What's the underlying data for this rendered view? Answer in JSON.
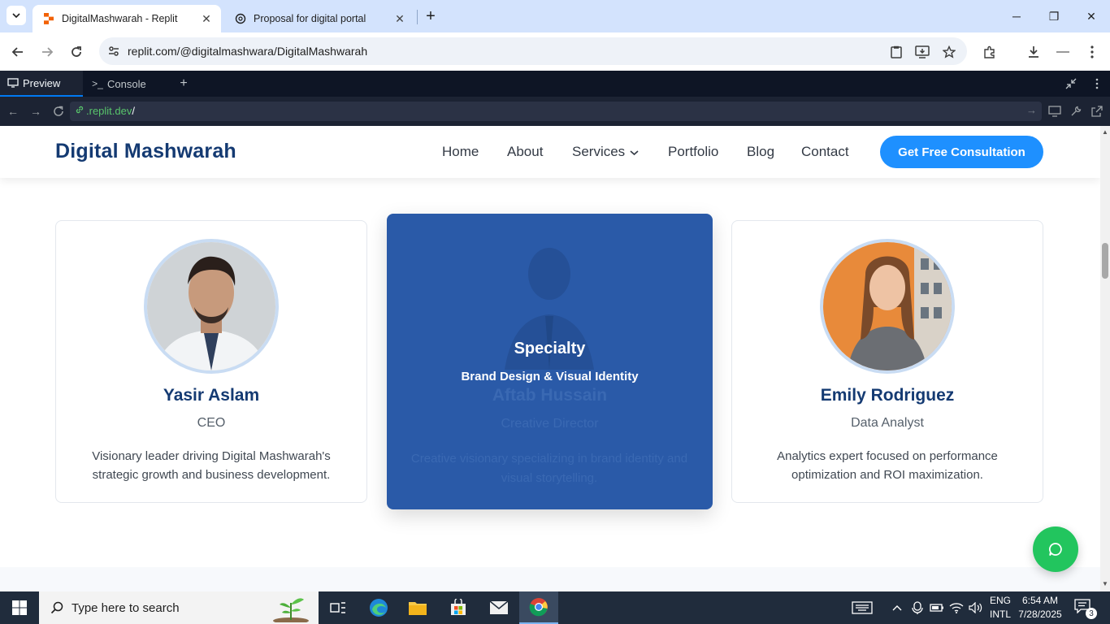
{
  "browser": {
    "tabs": [
      {
        "title": "DigitalMashwarah - Replit",
        "active": true,
        "icon": "replit-icon"
      },
      {
        "title": "Proposal for digital portal",
        "active": false,
        "icon": "openai-icon"
      }
    ],
    "url": "replit.com/@digitalmashwara/DigitalMashwarah"
  },
  "replit": {
    "tabs": [
      {
        "label": "Preview",
        "icon": "monitor-icon"
      },
      {
        "label": "Console",
        "icon": "terminal-icon"
      }
    ],
    "address": {
      "domain": ".replit.dev",
      "path": "/"
    }
  },
  "site": {
    "logo": "Digital Mashwarah",
    "nav": [
      "Home",
      "About",
      "Services",
      "Portfolio",
      "Blog",
      "Contact"
    ],
    "cta": "Get Free Consultation",
    "team": [
      {
        "name": "Yasir Aslam",
        "role": "CEO",
        "desc": "Visionary leader driving Digital Mashwarah's strategic growth and business development."
      },
      {
        "name": "Aftab Hussain",
        "role": "Creative Director",
        "desc": "Creative visionary specializing in brand identity and visual storytelling.",
        "overlay_title": "Specialty",
        "overlay_text": "Brand Design & Visual Identity"
      },
      {
        "name": "Emily Rodriguez",
        "role": "Data Analyst",
        "desc": "Analytics expert focused on performance optimization and ROI maximization."
      }
    ],
    "colors": {
      "brand_navy": "#143a72",
      "cta_blue": "#1e90ff",
      "hover_card": "#2a5aa8",
      "chat_green": "#22c55e"
    }
  },
  "taskbar": {
    "search_placeholder": "Type here to search",
    "lang_top": "ENG",
    "lang_bottom": "INTL",
    "time": "6:54 AM",
    "date": "7/28/2025",
    "notifications": "3"
  }
}
